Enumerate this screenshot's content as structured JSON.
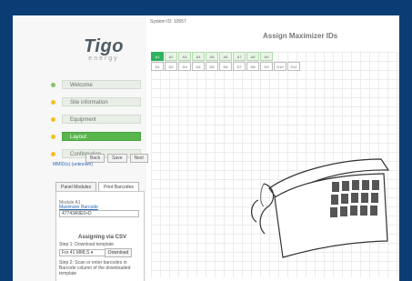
{
  "system_id": "System ID: 10557",
  "title": "Assign Maximizer IDs",
  "logo": {
    "main": "Tigo",
    "sub": "energy"
  },
  "sidebar": {
    "items": [
      {
        "label": "Welcome",
        "active": false,
        "dot": "green"
      },
      {
        "label": "Site information",
        "active": false,
        "dot": "yellow"
      },
      {
        "label": "Equipment",
        "active": false,
        "dot": "yellow"
      },
      {
        "label": "Layout",
        "active": true,
        "dot": "yellow"
      },
      {
        "label": "Confirmation",
        "active": false,
        "dot": "yellow"
      }
    ],
    "buttons": {
      "back": "Back",
      "save": "Save",
      "next": "Next"
    },
    "link": "MMID(s) (unknown)",
    "tabs": {
      "panel_modules": "Panel Modules",
      "print_barcodes": "Print Barcodes"
    },
    "module_label": "Module A1",
    "max_barcode_label": "Maximizer Barcode",
    "barcode_input": "47743A9E0+D",
    "csv_heading": "Assigning via CSV",
    "step1": "Step 1: Download template",
    "select_value": "For 41 MMLS",
    "download_label": "Download",
    "step2": "Step 2: Scan or enter barcodes in Barcode column of the downloaded template"
  },
  "main": {
    "row1": [
      "A1",
      "A2",
      "A3",
      "A4",
      "A5",
      "A6",
      "A7",
      "A8",
      "A9"
    ],
    "row2": [
      "D1",
      "D2",
      "D3",
      "D4",
      "D5",
      "D6",
      "D7",
      "D8",
      "D9",
      "D10",
      "D11"
    ]
  }
}
